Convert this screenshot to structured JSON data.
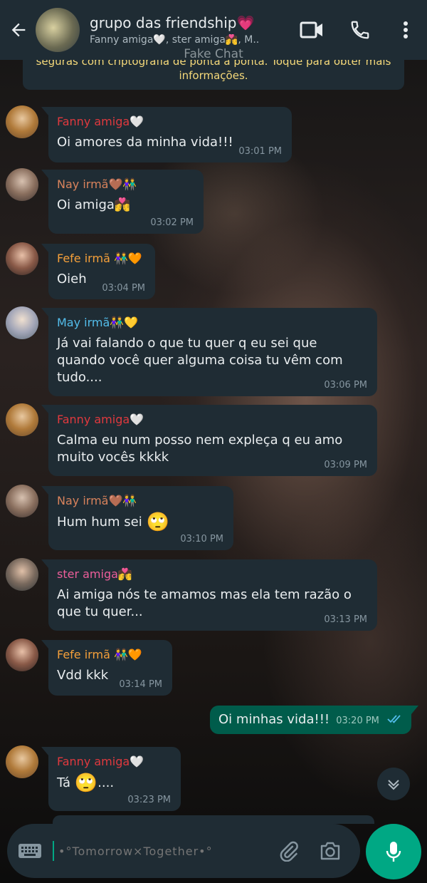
{
  "header": {
    "group_name": "grupo das friendship💗",
    "members": "Fanny amiga🤍, ster amiga💏, M..",
    "watermark": "Fake Chat"
  },
  "notice": {
    "line1": "seguras com criptografia de ponta a ponta. Toque para obter mais",
    "line2": "informações."
  },
  "messages": [
    {
      "sender": "Fanny amiga🤍",
      "text": "Oi amores da minha vida!!!",
      "time": "03:01 PM"
    },
    {
      "sender": "Nay irmã🤎👫",
      "text": "Oi amiga💏",
      "time": "03:02 PM"
    },
    {
      "sender": "Fefe irmã 👫🧡",
      "text": "Oieh",
      "time": "03:04 PM"
    },
    {
      "sender": "May irmã👫💛",
      "text": "Já vai falando o que tu quer q eu sei que quando você quer alguma coisa tu vêm com tudo....",
      "time": "03:06 PM"
    },
    {
      "sender": "Fanny amiga🤍",
      "text": "Calma eu num posso nem expleça  q eu amo muito vocês kkkk",
      "time": "03:09 PM"
    },
    {
      "sender": "Nay irmã🤎👫",
      "text": "Hum hum sei",
      "emoji": "🙄",
      "time": "03:10 PM"
    },
    {
      "sender": "ster amiga💏",
      "text": "Ai amiga nós te amamos mas ela tem razão o que tu quer...",
      "time": "03:13 PM"
    },
    {
      "sender": "Fefe irmã 👫🧡",
      "text": "Vdd kkk",
      "time": "03:14 PM"
    },
    {
      "sender": "Fanny amiga🤍",
      "text_pre": "Tá ",
      "emoji": "🙄",
      "text_post": "....",
      "time": "03:23 PM"
    }
  ],
  "outgoing": {
    "text": "Oi minhas vida!!!",
    "time": "03:20 PM"
  },
  "composer": {
    "placeholder": "•°Tomorrow×Together•°"
  },
  "colors": {
    "header_bg": "#1f2c34",
    "bubble_in": "#1f2c34",
    "bubble_out": "#005c4b",
    "accent": "#00a884"
  },
  "icons": [
    "back-arrow-icon",
    "video-call-icon",
    "phone-icon",
    "more-icon",
    "chevron-down-icon",
    "keyboard-icon",
    "paperclip-icon",
    "camera-icon",
    "microphone-icon",
    "double-check-icon"
  ]
}
